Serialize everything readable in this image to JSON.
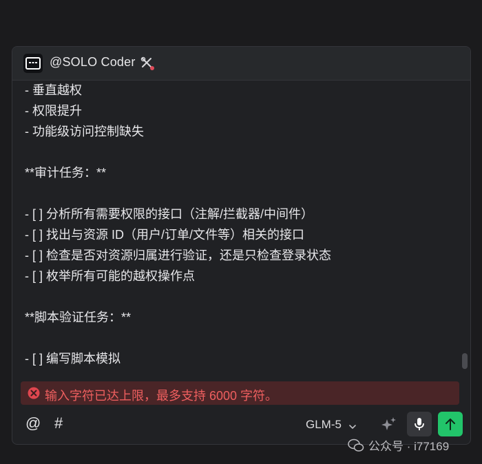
{
  "header": {
    "agent_name": "@SOLO Coder"
  },
  "content": {
    "lines": [
      "- 垂直越权",
      "- 权限提升",
      "- 功能级访问控制缺失",
      "",
      "**审计任务：**",
      "",
      "- [ ] 分析所有需要权限的接口（注解/拦截器/中间件）",
      "- [ ] 找出与资源 ID（用户/订单/文件等）相关的接口",
      "- [ ] 检查是否对资源归属进行验证，还是只检查登录状态",
      "- [ ] 枚举所有可能的越权操作点",
      "",
      "**脚本验证任务：**",
      "",
      "- [ ] 编写脚本模拟"
    ]
  },
  "error": {
    "message": "输入字符已达上限，最多支持 6000 字符。",
    "color": "#ef5f5f"
  },
  "toolbar": {
    "at_label": "@",
    "hash_label": "#",
    "model": "GLM-5",
    "send_color": "#22c46a"
  },
  "watermark": {
    "text": "公众号 · i77169"
  }
}
